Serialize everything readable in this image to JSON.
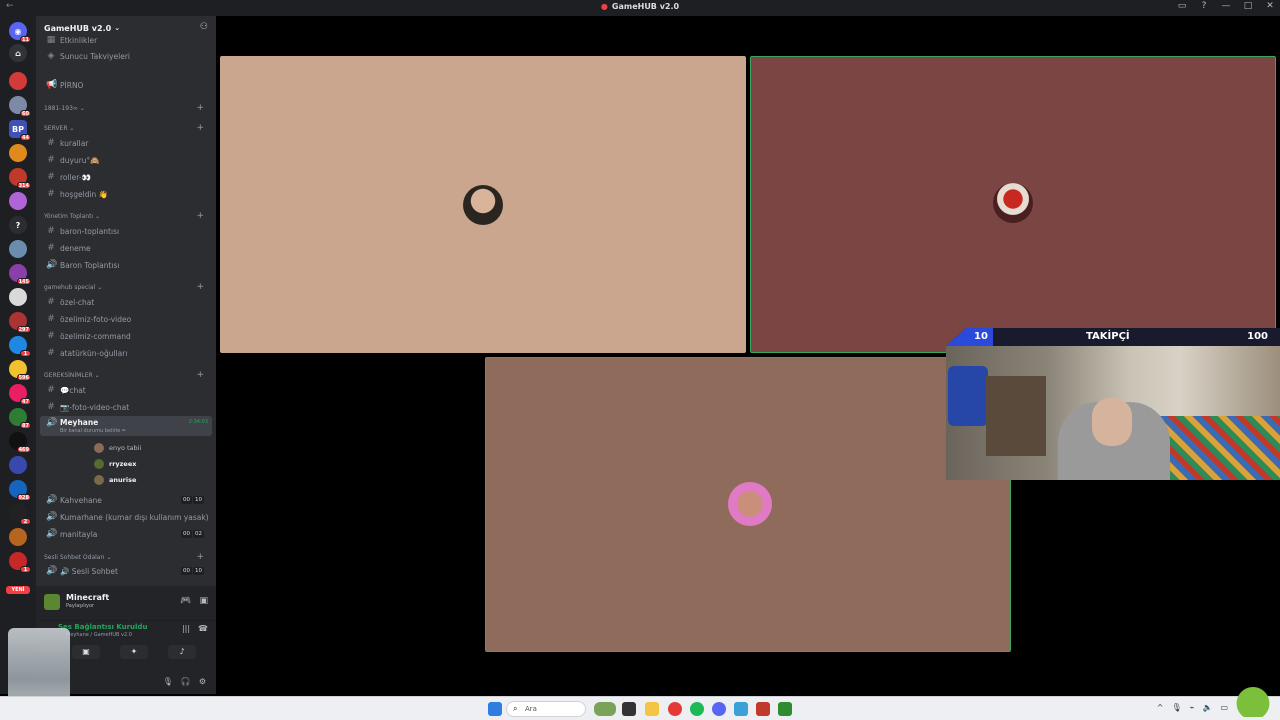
{
  "window": {
    "title": "GameHUB v2.0",
    "back_glyph": "←",
    "controls": [
      "▭",
      "?",
      "—",
      "□",
      "✕"
    ]
  },
  "rail": {
    "badges": [
      "11",
      "60",
      "44",
      "314",
      "145",
      "297",
      "1",
      "596",
      "47",
      "87",
      "469",
      "928",
      "2",
      "1"
    ],
    "new_label": "YENİ"
  },
  "sidebar": {
    "guild_name": "GameHUB v2.0",
    "channels": {
      "events": "Etkinlikler",
      "boosts": "Sunucu Takviyeleri",
      "pirno": "PİRNO",
      "cat_1881": "1881-193∞",
      "cat_server": "SERVER",
      "kurallar": "kurallar",
      "duyuru": "duyuru°🙈",
      "roller": "roller-👀",
      "hosgeldin": "hoşgeldin 👋",
      "cat_yonetim": "Yönetim Toplantı",
      "baron_toplantisi": "baron-toplantısı",
      "deneme": "deneme",
      "baron_voice": "Baron Toplantısı",
      "cat_gamehub": "gamehub special",
      "ozel_chat": "özel-chat",
      "ozel_foto": "özelimiz-foto-video",
      "ozel_command": "özelimiz-command",
      "ataturk": "atatürkün-oğulları",
      "cat_gereksinimler": "GEREKSİNİMLER",
      "chat": "💬chat",
      "foto_chat": "📷-foto-video-chat",
      "meyhane": "Meyhane",
      "meyhane_sub": "Bir kanal durumu belirle ✏",
      "meyhane_time": "2:34:03",
      "kahvehane": "Kahvehane",
      "kahvehane_counts": [
        "00",
        "10"
      ],
      "kumarhane": "Kumarhane (kumar dışı kullanım yasak)",
      "manitayla": "manitayla",
      "manitayla_counts": [
        "00",
        "02"
      ],
      "cat_sesli": "Sesli Sohbet Odaları",
      "sesli": "🔊 Sesli Sohbet",
      "sesli_counts": [
        "00",
        "10"
      ]
    },
    "voice_users": [
      "enyo tabii",
      "rryzeex",
      "anurise"
    ],
    "activity": {
      "game": "Minecraft",
      "sub": "Paylaşılıyor"
    },
    "voice": {
      "status": "Ses Bağlantısı Kuruldu",
      "sub": "Meyhane / GameHUB v2.0"
    }
  },
  "overlay": {
    "current": "10",
    "label": "TAKİPÇİ",
    "goal": "100",
    "progress": 0.1
  },
  "taskbar": {
    "search": "Ara"
  },
  "colors": {
    "accent_green": "#23a55a",
    "tile1": "#c9a68d",
    "tile2": "#7a4542",
    "tile3": "#8e6b5a"
  }
}
